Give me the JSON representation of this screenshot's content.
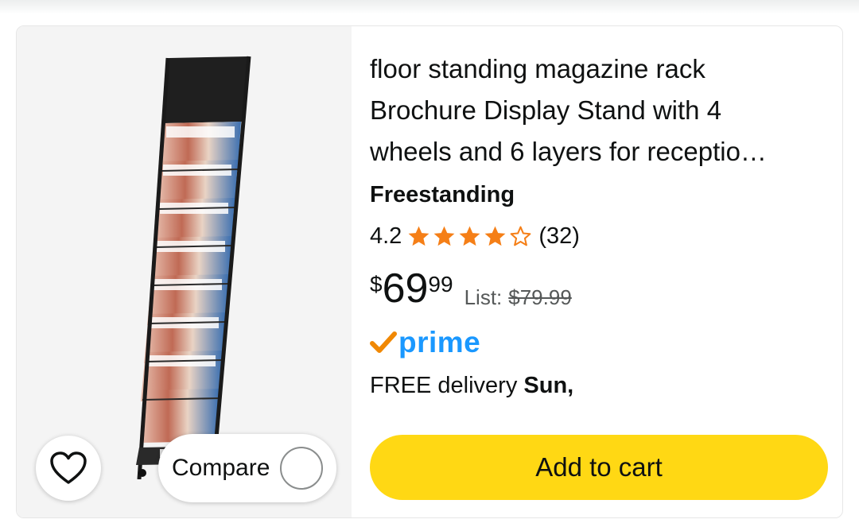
{
  "product": {
    "title_lines": [
      "floor standing magazine rack",
      "Brochure Display Stand with 4",
      "wheels and 6 layers for receptio…"
    ],
    "style": "Freestanding",
    "rating": {
      "value": "4.2",
      "stars_filled": 4,
      "stars_total": 5,
      "count": "(32)"
    },
    "price": {
      "currency": "$",
      "whole": "69",
      "fraction": "99",
      "list_label": "List:",
      "list_price": "$79.99"
    },
    "prime": {
      "label": "prime",
      "icon": "check-icon",
      "check_color": "#f08804",
      "text_color": "#1a98ff"
    },
    "delivery": {
      "prefix": "FREE delivery",
      "date": "Sun,"
    },
    "add_to_cart_label": "Add to cart",
    "image_icon": "magazine-rack-image"
  },
  "actions": {
    "wishlist_icon": "heart-icon",
    "compare_label": "Compare"
  },
  "colors": {
    "star": "#f57f17",
    "button": "#ffd814",
    "image_background": "#f4f4f4"
  }
}
